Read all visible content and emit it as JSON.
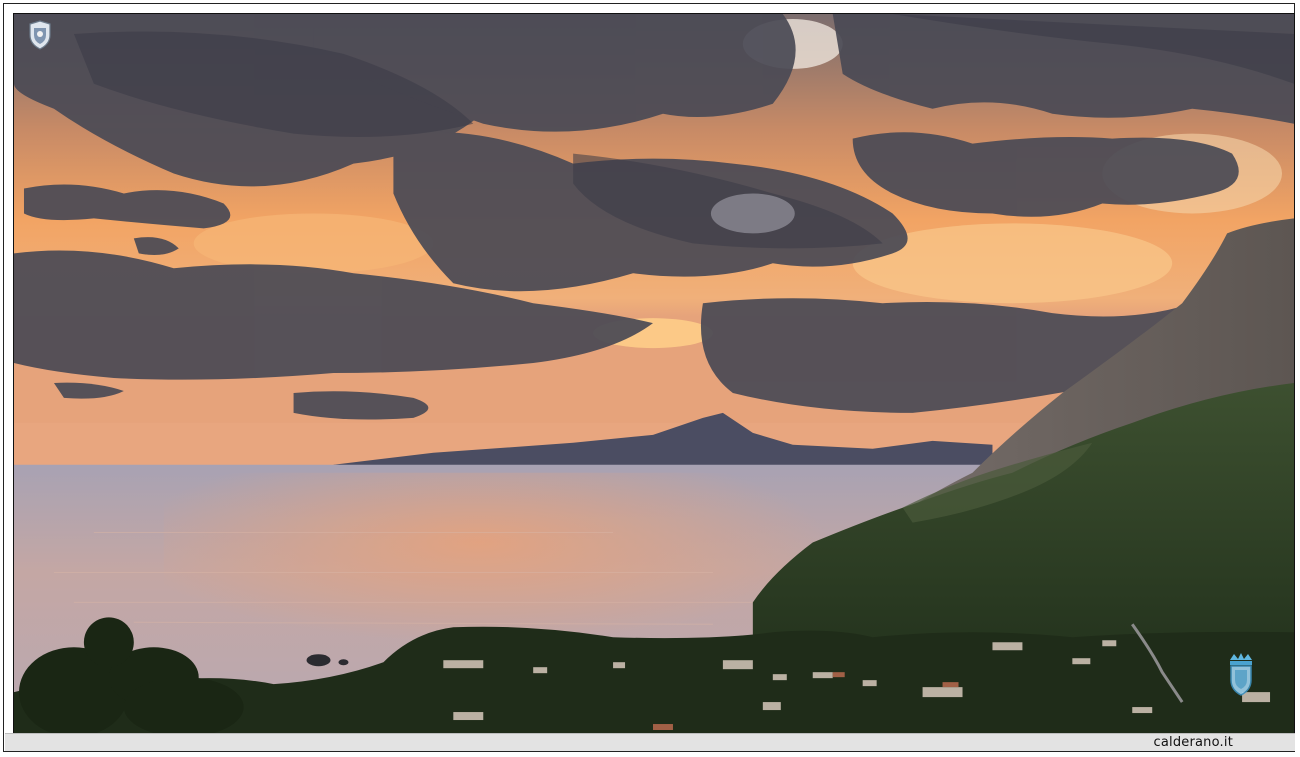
{
  "watermark": {
    "site": "calderano.it",
    "top_left_logo_icon": "crest-icon",
    "bottom_right_logo_icon": "crest-icon"
  },
  "colors": {
    "sky_glow": "#f0a060",
    "cloud_dark": "#4a4a55",
    "sea": "#b9a7a8",
    "mountain_silhouette": "#4b4d62",
    "vegetation": "#27381f"
  }
}
